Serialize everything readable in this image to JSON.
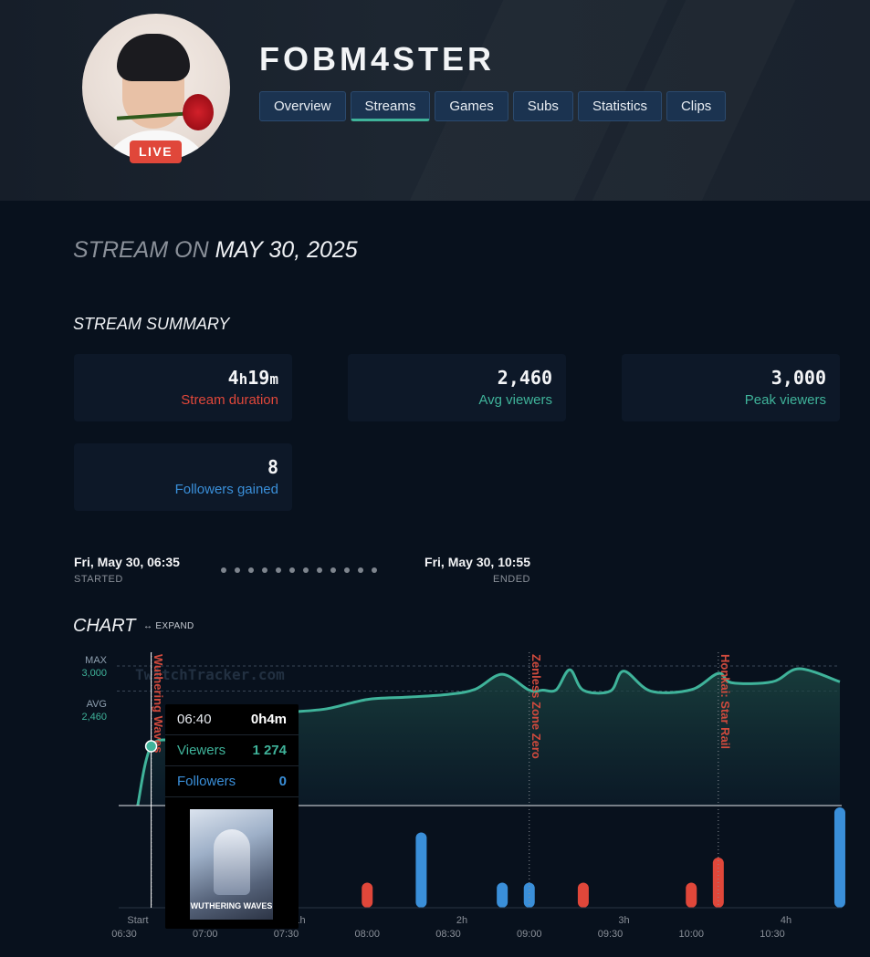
{
  "channel": {
    "name": "FOBM4STER",
    "live_badge": "LIVE"
  },
  "tabs": [
    {
      "label": "Overview"
    },
    {
      "label": "Streams",
      "active": true
    },
    {
      "label": "Games"
    },
    {
      "label": "Subs"
    },
    {
      "label": "Statistics"
    },
    {
      "label": "Clips"
    }
  ],
  "stream": {
    "title_prefix": "STREAM ON",
    "date": "MAY 30, 2025"
  },
  "summary": {
    "title": "STREAM SUMMARY",
    "cards": [
      {
        "value_num1": "4",
        "value_unit1": "h",
        "value_num2": "19",
        "value_unit2": "m",
        "label": "Stream duration",
        "color": "#e0473a"
      },
      {
        "value": "2,460",
        "label": "Avg viewers",
        "color": "#3fb39a"
      },
      {
        "value": "3,000",
        "label": "Peak viewers",
        "color": "#3fb39a"
      },
      {
        "value": "8",
        "label": "Followers gained",
        "color": "#3a8fd9"
      }
    ]
  },
  "times": {
    "started": "Fri, May 30, 06:35",
    "started_label": "STARTED",
    "ended": "Fri, May 30, 10:55",
    "ended_label": "ENDED"
  },
  "chart_section": {
    "title": "CHART",
    "expand_label": "↔ EXPAND",
    "watermark": "TwitchTracker.com"
  },
  "chart_data": {
    "type": "area",
    "y_reference": {
      "max_label": "MAX",
      "max_value": "3,000",
      "avg_label": "AVG",
      "avg_value": "2,460"
    },
    "x_labels_top": [
      "Start",
      "1h",
      "2h",
      "3h",
      "4h"
    ],
    "x_labels_bottom": [
      "06:30",
      "07:00",
      "07:30",
      "08:00",
      "08:30",
      "09:00",
      "09:30",
      "10:00",
      "10:30"
    ],
    "viewers": {
      "name": "Viewers",
      "x": [
        "06:35",
        "06:40",
        "06:50",
        "07:00",
        "07:15",
        "07:30",
        "07:45",
        "08:00",
        "08:15",
        "08:30",
        "08:40",
        "08:50",
        "09:00",
        "09:05",
        "09:10",
        "09:15",
        "09:20",
        "09:30",
        "09:35",
        "09:45",
        "10:00",
        "10:10",
        "10:15",
        "10:30",
        "10:40",
        "10:55"
      ],
      "y": [
        0,
        1274,
        1420,
        1630,
        1900,
        2000,
        2080,
        2280,
        2330,
        2390,
        2500,
        2820,
        2480,
        2480,
        2490,
        2920,
        2480,
        2460,
        2890,
        2460,
        2490,
        2840,
        2640,
        2660,
        2940,
        2660
      ]
    },
    "followers": {
      "name": "Followers",
      "x": [
        "07:30",
        "08:00",
        "08:20",
        "08:50",
        "09:00",
        "09:20",
        "10:00",
        "10:10",
        "10:55"
      ],
      "y": [
        2,
        1,
        3,
        1,
        1,
        1,
        1,
        2,
        4
      ],
      "colors": [
        "#3a8fd9",
        "#e0473a",
        "#3a8fd9",
        "#3a8fd9",
        "#3a8fd9",
        "#e0473a",
        "#e0473a",
        "#e0473a",
        "#3a8fd9"
      ]
    },
    "game_changes": [
      {
        "time": "06:35",
        "name": "Wuthering Waves"
      },
      {
        "time": "09:00",
        "name": "Zenless Zone Zero"
      },
      {
        "time": "10:10",
        "name": "Honkai: Star Rail"
      }
    ],
    "colors": {
      "viewers": "#3fb39a",
      "followers": "#3a8fd9",
      "game_marker": "#d04a3d"
    }
  },
  "tooltip": {
    "time": "06:40",
    "elapsed": "0h4m",
    "viewers_label": "Viewers",
    "viewers_value": "1 274",
    "followers_label": "Followers",
    "followers_value": "0",
    "game_cover_title": "WUTHERING WAVES"
  }
}
